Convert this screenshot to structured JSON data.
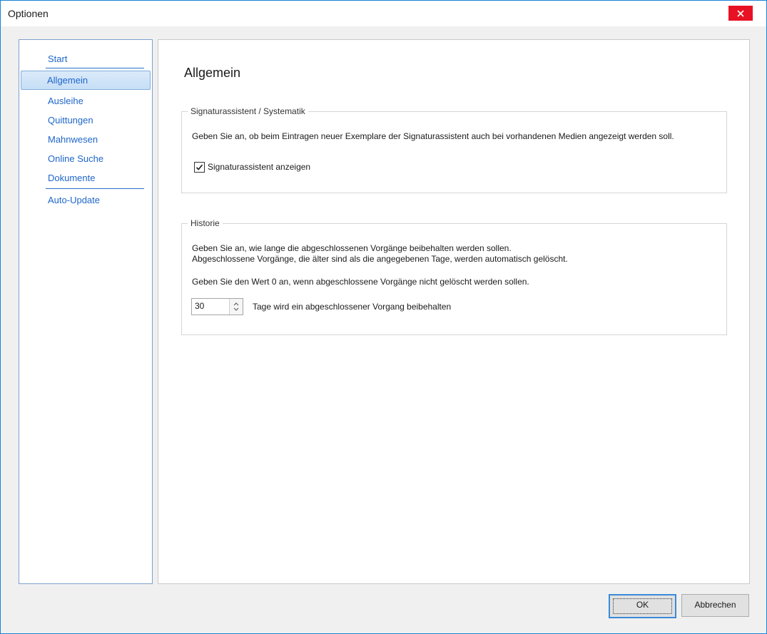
{
  "window": {
    "title": "Optionen"
  },
  "sidebar": {
    "items": [
      {
        "label": "Start",
        "selected": false
      },
      {
        "label": "Allgemein",
        "selected": true
      },
      {
        "label": "Ausleihe",
        "selected": false
      },
      {
        "label": "Quittungen",
        "selected": false
      },
      {
        "label": "Mahnwesen",
        "selected": false
      },
      {
        "label": "Online Suche",
        "selected": false
      },
      {
        "label": "Dokumente",
        "selected": false
      },
      {
        "label": "Auto-Update",
        "selected": false
      }
    ]
  },
  "main": {
    "title": "Allgemein",
    "signatur_group": {
      "label": "Signaturassistent / Systematik",
      "description": "Geben Sie an, ob beim Eintragen neuer Exemplare der Signaturassistent auch bei vorhandenen Medien angezeigt werden soll.",
      "checkbox_label": "Signaturassistent anzeigen",
      "checkbox_checked": true
    },
    "historie_group": {
      "label": "Historie",
      "line1": "Geben Sie an, wie lange die abgeschlossenen Vorgänge beibehalten werden sollen.",
      "line2": "Abgeschlossene Vorgänge, die älter sind als die angegebenen Tage, werden automatisch gelöscht.",
      "line3": "Geben Sie den Wert 0 an, wenn abgeschlossene Vorgänge nicht gelöscht werden sollen.",
      "days_value": "30",
      "days_suffix": "Tage wird ein abgeschlossener Vorgang beibehalten"
    }
  },
  "footer": {
    "ok_label": "OK",
    "cancel_label": "Abbrechen"
  },
  "colors": {
    "accent": "#1883d7",
    "close": "#e81123",
    "nav_link": "#1e66c9"
  }
}
